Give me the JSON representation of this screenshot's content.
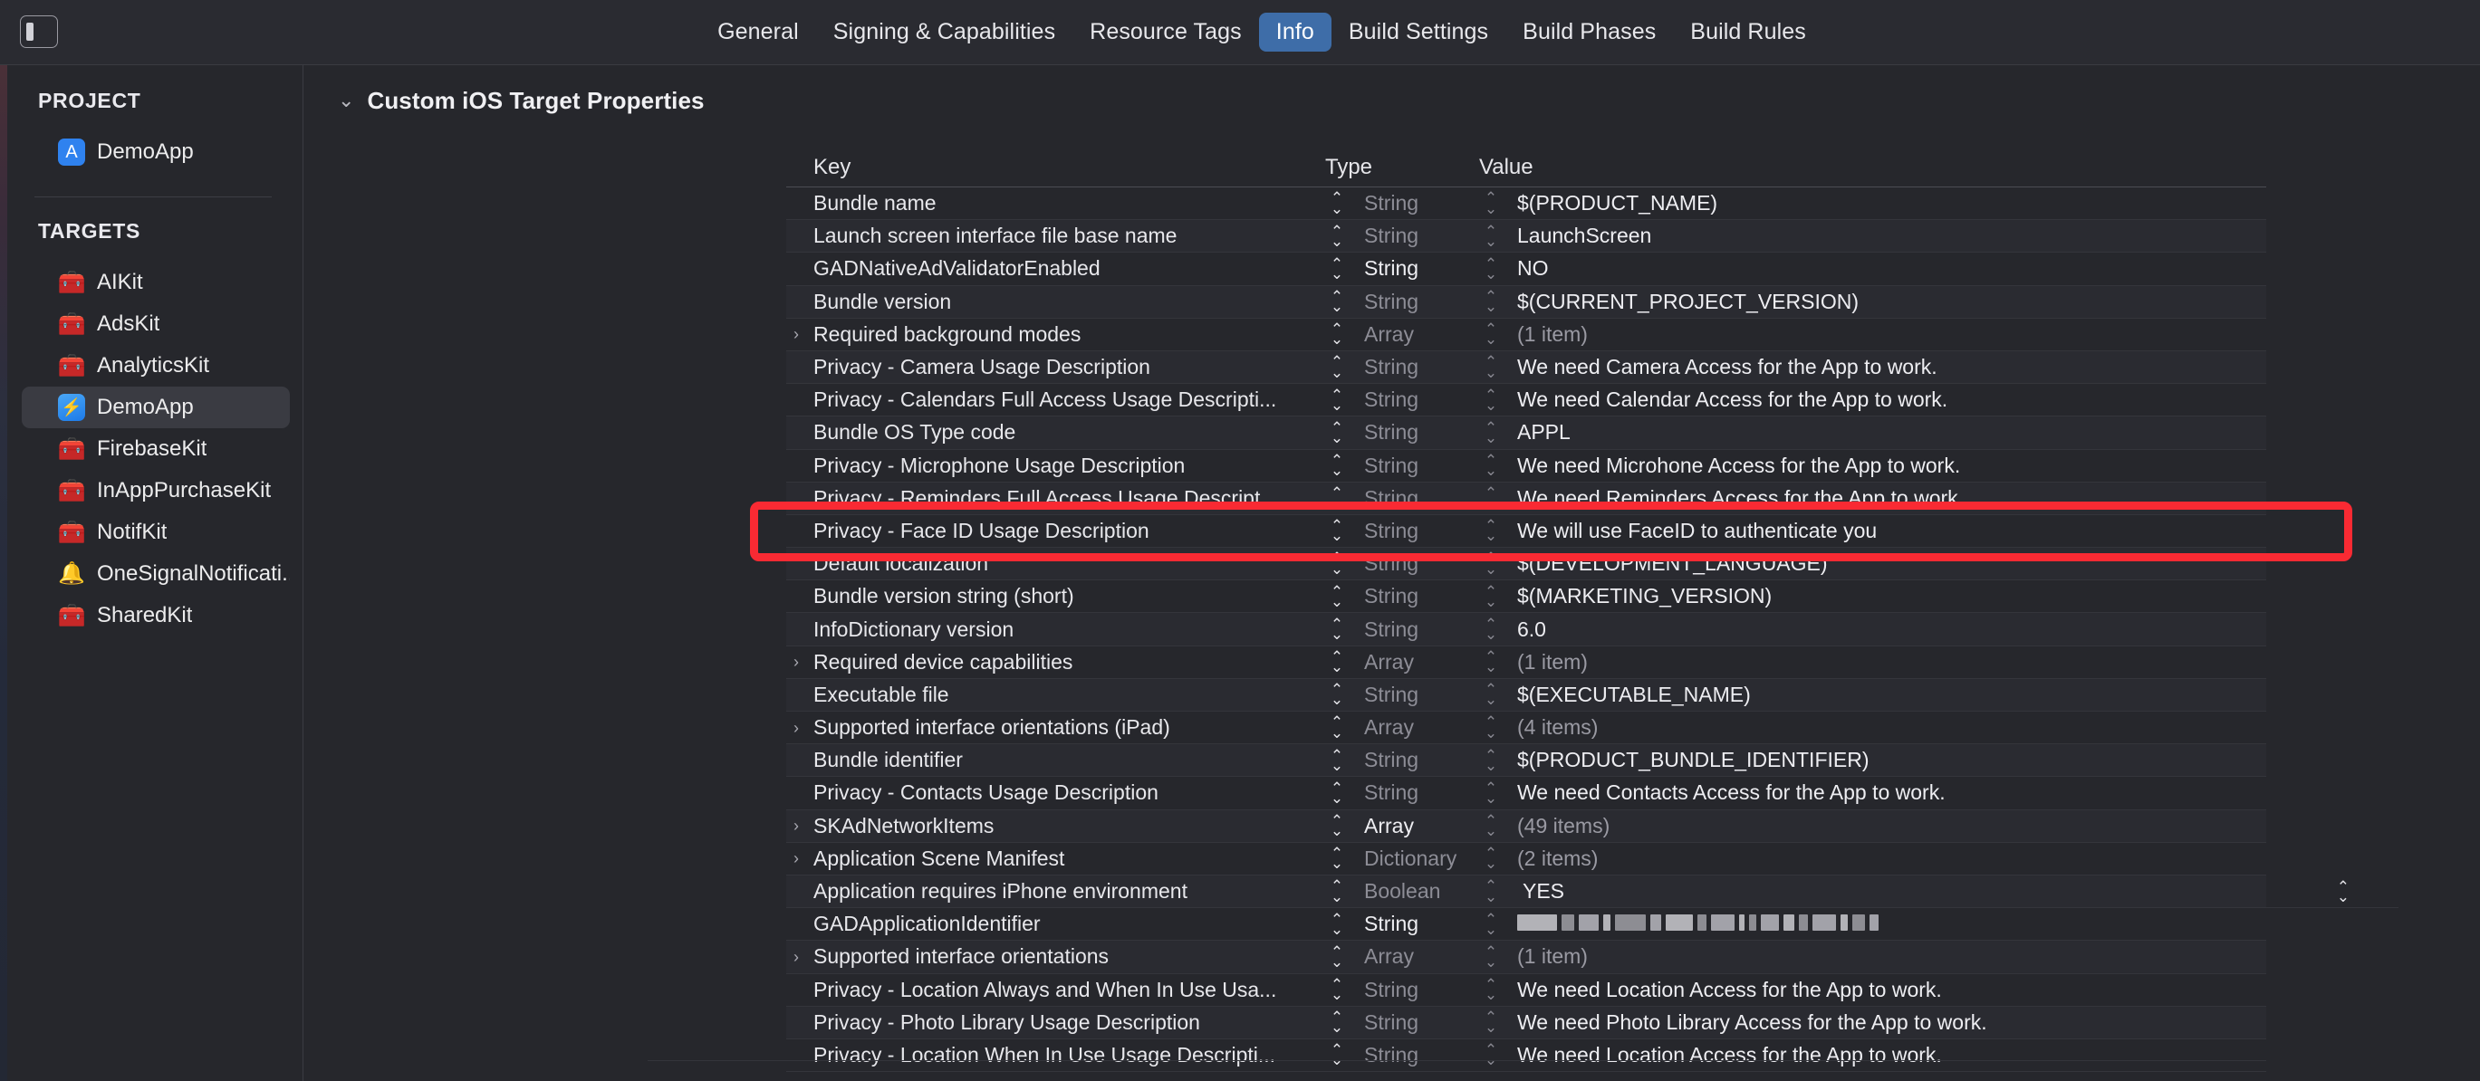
{
  "toolbar": {
    "panel_toggle_icon": "sidebar-toggle-icon",
    "tabs": [
      {
        "label": "General",
        "active": false
      },
      {
        "label": "Signing & Capabilities",
        "active": false
      },
      {
        "label": "Resource Tags",
        "active": false
      },
      {
        "label": "Info",
        "active": true
      },
      {
        "label": "Build Settings",
        "active": false
      },
      {
        "label": "Build Phases",
        "active": false
      },
      {
        "label": "Build Rules",
        "active": false
      }
    ]
  },
  "sidebar": {
    "project_header": "PROJECT",
    "targets_header": "TARGETS",
    "project_items": [
      {
        "label": "DemoApp",
        "icon": "appstore-icon",
        "selected": false
      }
    ],
    "target_items": [
      {
        "label": "AIKit",
        "icon": "toolbox-icon",
        "selected": false
      },
      {
        "label": "AdsKit",
        "icon": "toolbox-icon",
        "selected": false
      },
      {
        "label": "AnalyticsKit",
        "icon": "toolbox-icon",
        "selected": false
      },
      {
        "label": "DemoApp",
        "icon": "lightning-icon",
        "selected": true
      },
      {
        "label": "FirebaseKit",
        "icon": "toolbox-icon",
        "selected": false
      },
      {
        "label": "InAppPurchaseKit",
        "icon": "toolbox-icon",
        "selected": false
      },
      {
        "label": "NotifKit",
        "icon": "toolbox-icon",
        "selected": false
      },
      {
        "label": "OneSignalNotificati...",
        "icon": "bell-icon",
        "selected": false
      },
      {
        "label": "SharedKit",
        "icon": "toolbox-icon",
        "selected": false
      }
    ]
  },
  "main": {
    "section_title": "Custom iOS Target Properties",
    "disclosure_glyph": "⌄",
    "columns": {
      "key": "Key",
      "type": "Type",
      "value": "Value"
    },
    "rows": [
      {
        "key": "Bundle name",
        "expandable": false,
        "type": "String",
        "type_dim": true,
        "value": "$(PRODUCT_NAME)",
        "value_dim": false
      },
      {
        "key": "Launch screen interface file base name",
        "expandable": false,
        "type": "String",
        "type_dim": true,
        "value": "LaunchScreen",
        "value_dim": false
      },
      {
        "key": "GADNativeAdValidatorEnabled",
        "expandable": false,
        "type": "String",
        "type_dim": false,
        "value": "NO",
        "value_dim": false
      },
      {
        "key": "Bundle version",
        "expandable": false,
        "type": "String",
        "type_dim": true,
        "value": "$(CURRENT_PROJECT_VERSION)",
        "value_dim": false
      },
      {
        "key": "Required background modes",
        "expandable": true,
        "type": "Array",
        "type_dim": true,
        "value": "(1 item)",
        "value_dim": true
      },
      {
        "key": "Privacy - Camera Usage Description",
        "expandable": false,
        "type": "String",
        "type_dim": true,
        "value": "We need Camera Access for the App to work.",
        "value_dim": false
      },
      {
        "key": "Privacy - Calendars Full Access Usage Descripti...",
        "expandable": false,
        "type": "String",
        "type_dim": true,
        "value": "We need Calendar Access for the App to work.",
        "value_dim": false
      },
      {
        "key": "Bundle OS Type code",
        "expandable": false,
        "type": "String",
        "type_dim": true,
        "value": "APPL",
        "value_dim": false
      },
      {
        "key": "Privacy - Microphone Usage Description",
        "expandable": false,
        "type": "String",
        "type_dim": true,
        "value": "We need Microhone Access for the App to work.",
        "value_dim": false
      },
      {
        "key": "Privacy - Reminders Full Access Usage Descript...",
        "expandable": false,
        "type": "String",
        "type_dim": true,
        "value": "We need Reminders Access for the App to work.",
        "value_dim": false
      },
      {
        "key": "Privacy - Face ID Usage Description",
        "expandable": false,
        "type": "String",
        "type_dim": true,
        "value": "We will use FaceID to authenticate you",
        "value_dim": false,
        "highlighted": true
      },
      {
        "key": "Default localization",
        "expandable": false,
        "type": "String",
        "type_dim": true,
        "value": "$(DEVELOPMENT_LANGUAGE)",
        "value_dim": false
      },
      {
        "key": "Bundle version string (short)",
        "expandable": false,
        "type": "String",
        "type_dim": true,
        "value": "$(MARKETING_VERSION)",
        "value_dim": false
      },
      {
        "key": "InfoDictionary version",
        "expandable": false,
        "type": "String",
        "type_dim": true,
        "value": "6.0",
        "value_dim": false
      },
      {
        "key": "Required device capabilities",
        "expandable": true,
        "type": "Array",
        "type_dim": true,
        "value": "(1 item)",
        "value_dim": true
      },
      {
        "key": "Executable file",
        "expandable": false,
        "type": "String",
        "type_dim": true,
        "value": "$(EXECUTABLE_NAME)",
        "value_dim": false
      },
      {
        "key": "Supported interface orientations (iPad)",
        "expandable": true,
        "type": "Array",
        "type_dim": true,
        "value": "(4 items)",
        "value_dim": true
      },
      {
        "key": "Bundle identifier",
        "expandable": false,
        "type": "String",
        "type_dim": true,
        "value": "$(PRODUCT_BUNDLE_IDENTIFIER)",
        "value_dim": false
      },
      {
        "key": "Privacy - Contacts Usage Description",
        "expandable": false,
        "type": "String",
        "type_dim": true,
        "value": "We need Contacts Access for the App to work.",
        "value_dim": false
      },
      {
        "key": "SKAdNetworkItems",
        "expandable": true,
        "type": "Array",
        "type_dim": false,
        "value": "(49 items)",
        "value_dim": true
      },
      {
        "key": "Application Scene Manifest",
        "expandable": true,
        "type": "Dictionary",
        "type_dim": true,
        "value": "(2 items)",
        "value_dim": true
      },
      {
        "key": "Application requires iPhone environment",
        "expandable": false,
        "type": "Boolean",
        "type_dim": true,
        "value": "YES",
        "value_dim": false,
        "end_stepper": true
      },
      {
        "key": "GADApplicationIdentifier",
        "expandable": false,
        "type": "String",
        "type_dim": false,
        "value": "",
        "value_dim": false,
        "redacted": true
      },
      {
        "key": "Supported interface orientations",
        "expandable": true,
        "type": "Array",
        "type_dim": true,
        "value": "(1 item)",
        "value_dim": true
      },
      {
        "key": "Privacy - Location Always and When In Use Usa...",
        "expandable": false,
        "type": "String",
        "type_dim": true,
        "value": "We need Location Access for the App to work.",
        "value_dim": false
      },
      {
        "key": "Privacy - Photo Library Usage Description",
        "expandable": false,
        "type": "String",
        "type_dim": true,
        "value": "We need Photo Library Access for the App to work.",
        "value_dim": false
      },
      {
        "key": "Privacy - Location When In Use Usage Descripti...",
        "expandable": false,
        "type": "String",
        "type_dim": true,
        "value": "We need Location Access for the App to work.",
        "value_dim": false
      }
    ]
  },
  "annotation": {
    "highlight_color": "#f92a33",
    "highlight_target": "Privacy - Face ID Usage Description"
  },
  "icons": {
    "expand_arrow": "›",
    "stepper": "stepper-icon",
    "toolbox": "🧰",
    "bell": "🔔",
    "appstore": "🅐",
    "lightning": "⚡"
  }
}
